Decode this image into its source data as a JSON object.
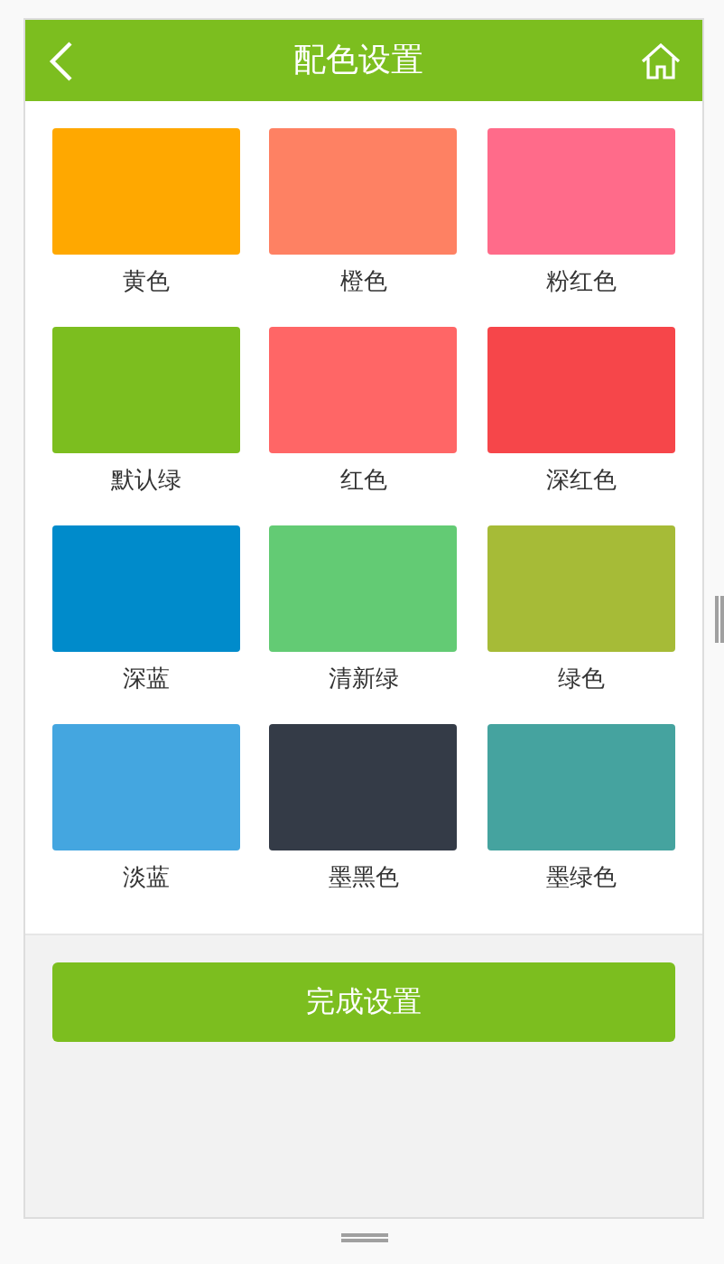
{
  "header": {
    "title": "配色设置"
  },
  "swatches": [
    {
      "label": "黄色",
      "color": "#ffa800"
    },
    {
      "label": "橙色",
      "color": "#fe8163"
    },
    {
      "label": "粉红色",
      "color": "#ff6b8a"
    },
    {
      "label": "默认绿",
      "color": "#7cbe1f"
    },
    {
      "label": "红色",
      "color": "#ff6666"
    },
    {
      "label": "深红色",
      "color": "#f6464a"
    },
    {
      "label": "深蓝",
      "color": "#008bcb"
    },
    {
      "label": "清新绿",
      "color": "#63cb74"
    },
    {
      "label": "绿色",
      "color": "#a6bb37"
    },
    {
      "label": "淡蓝",
      "color": "#44a6e0"
    },
    {
      "label": "墨黑色",
      "color": "#343b47"
    },
    {
      "label": "墨绿色",
      "color": "#45a39f"
    }
  ],
  "button": "完成设置"
}
